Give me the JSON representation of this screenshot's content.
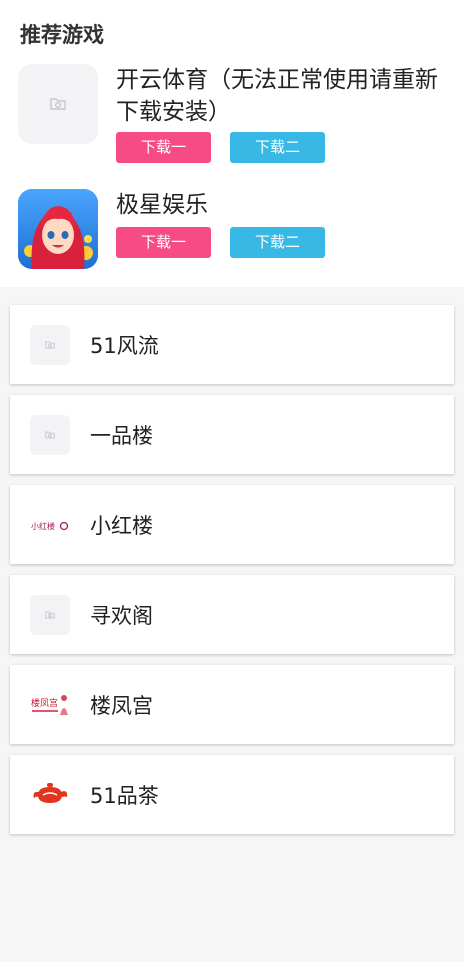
{
  "section": {
    "title": "推荐游戏"
  },
  "featured": [
    {
      "name": "开云体育（无法正常使用请重新下载安装）",
      "icon": "image-placeholder-icon",
      "btn1": "下载一",
      "btn2": "下载二"
    },
    {
      "name": "极星娱乐",
      "icon": "game-avatar-icon",
      "btn1": "下载一",
      "btn2": "下载二"
    }
  ],
  "list": [
    {
      "label": "51风流",
      "icon": "image-placeholder-icon"
    },
    {
      "label": "一品楼",
      "icon": "image-placeholder-icon"
    },
    {
      "label": "小红楼",
      "icon": "xiaohonglou-logo-icon",
      "logo_text": "小红楼"
    },
    {
      "label": "寻欢阁",
      "icon": "image-placeholder-icon"
    },
    {
      "label": "楼凤宫",
      "icon": "loufenggong-logo-icon",
      "logo_text": "楼凤宫"
    },
    {
      "label": "51品茶",
      "icon": "teapot-logo-icon"
    }
  ],
  "colors": {
    "pink": "#f64b85",
    "blue": "#38b8e4",
    "background": "#f6f6f6"
  }
}
